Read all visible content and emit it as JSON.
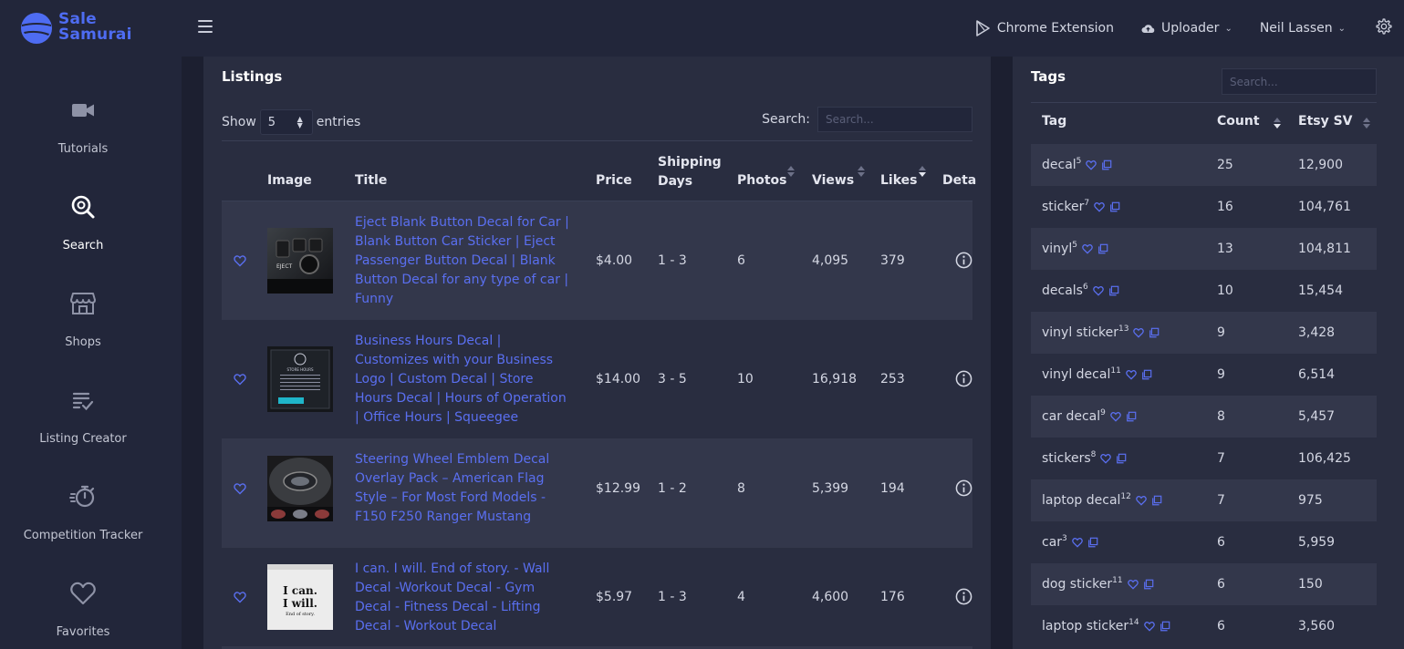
{
  "header": {
    "logo_line1": "Sale",
    "logo_line2": "Samurai",
    "chrome_extension": "Chrome Extension",
    "uploader": "Uploader",
    "user": "Neil Lassen"
  },
  "sidebar": {
    "items": [
      {
        "label": "Tutorials",
        "icon": "video-camera-icon"
      },
      {
        "label": "Search",
        "icon": "search-icon",
        "active": true
      },
      {
        "label": "Shops",
        "icon": "store-icon"
      },
      {
        "label": "Listing Creator",
        "icon": "list-check-icon"
      },
      {
        "label": "Competition Tracker",
        "icon": "stopwatch-icon"
      },
      {
        "label": "Favorites",
        "icon": "heart-icon"
      }
    ]
  },
  "listings": {
    "title": "Listings",
    "show_label": "Show",
    "entries_value": "5",
    "entries_label": "entries",
    "search_label": "Search:",
    "search_placeholder": "Search...",
    "columns": [
      "Image",
      "Title",
      "Price",
      "Shipping Days",
      "Photos",
      "Views",
      "Likes",
      "Deta"
    ],
    "col_shipping_1": "Shipping",
    "col_shipping_2": "Days",
    "rows": [
      {
        "title": "Eject Blank Button Decal for Car | Blank Button Car Sticker | Eject Passenger Button Decal | Blank Button Decal for any type of car | Funny",
        "price": "$4.00",
        "shipping": "1 - 3",
        "photos": "6",
        "views": "4,095",
        "likes": "379"
      },
      {
        "title": "Business Hours Decal | Customizes with your Business Logo | Custom Decal | Store Hours Decal | Hours of Operation | Office Hours | Squeegee",
        "price": "$14.00",
        "shipping": "3 - 5",
        "photos": "10",
        "views": "16,918",
        "likes": "253"
      },
      {
        "title": "Steering Wheel Emblem Decal Overlay Pack – American Flag Style – For Most Ford Models - F150 F250 Ranger Mustang",
        "price": "$12.99",
        "shipping": "1 - 2",
        "photos": "8",
        "views": "5,399",
        "likes": "194"
      },
      {
        "title": "I can. I will. End of story. - Wall Decal -Workout Decal - Gym Decal - Fitness Decal - Lifting Decal - Workout Decal",
        "price": "$5.97",
        "shipping": "1 - 3",
        "photos": "4",
        "views": "4,600",
        "likes": "176"
      }
    ],
    "thumb_text": {
      "eject": "EJECT",
      "store": "STORE HOURS",
      "quote_1": "I can.",
      "quote_2": "I will.",
      "quote_3": "End of story."
    }
  },
  "tags": {
    "title": "Tags",
    "search_placeholder": "Search...",
    "columns": [
      "Tag",
      "Count",
      "Etsy SV"
    ],
    "rows": [
      {
        "tag": "decal",
        "sup": "5",
        "count": "25",
        "sv": "12,900"
      },
      {
        "tag": "sticker",
        "sup": "7",
        "count": "16",
        "sv": "104,761"
      },
      {
        "tag": "vinyl",
        "sup": "5",
        "count": "13",
        "sv": "104,811"
      },
      {
        "tag": "decals",
        "sup": "6",
        "count": "10",
        "sv": "15,454"
      },
      {
        "tag": "vinyl sticker",
        "sup": "13",
        "count": "9",
        "sv": "3,428"
      },
      {
        "tag": "vinyl decal",
        "sup": "11",
        "count": "9",
        "sv": "6,514"
      },
      {
        "tag": "car decal",
        "sup": "9",
        "count": "8",
        "sv": "5,457"
      },
      {
        "tag": "stickers",
        "sup": "8",
        "count": "7",
        "sv": "106,425"
      },
      {
        "tag": "laptop decal",
        "sup": "12",
        "count": "7",
        "sv": "975"
      },
      {
        "tag": "car",
        "sup": "3",
        "count": "6",
        "sv": "5,959"
      },
      {
        "tag": "dog sticker",
        "sup": "11",
        "count": "6",
        "sv": "150"
      },
      {
        "tag": "laptop sticker",
        "sup": "14",
        "count": "6",
        "sv": "3,560"
      }
    ]
  },
  "colors": {
    "background": "#22263a",
    "panel": "#292d40",
    "row_alt": "#33374b",
    "accent": "#5a6ff0"
  }
}
